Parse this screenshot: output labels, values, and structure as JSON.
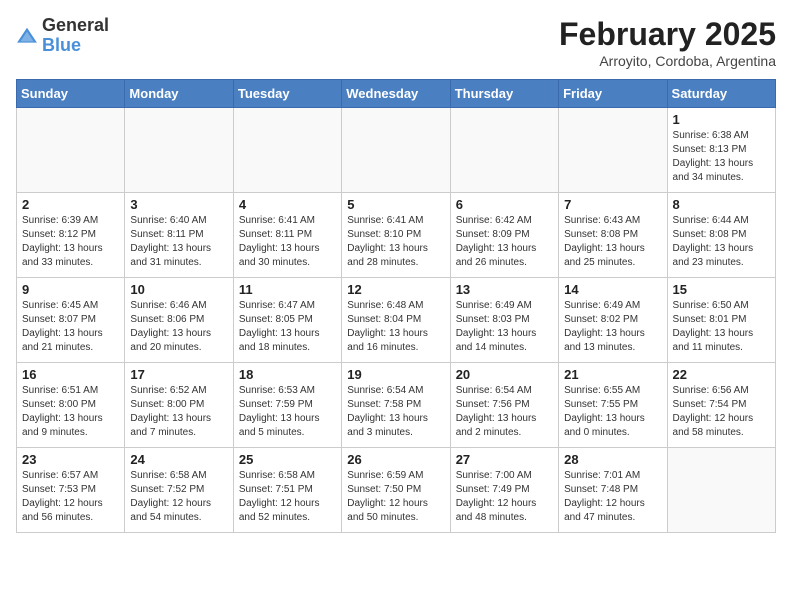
{
  "header": {
    "logo_general": "General",
    "logo_blue": "Blue",
    "month_title": "February 2025",
    "location": "Arroyito, Cordoba, Argentina"
  },
  "days_of_week": [
    "Sunday",
    "Monday",
    "Tuesday",
    "Wednesday",
    "Thursday",
    "Friday",
    "Saturday"
  ],
  "weeks": [
    [
      {
        "day": "",
        "info": ""
      },
      {
        "day": "",
        "info": ""
      },
      {
        "day": "",
        "info": ""
      },
      {
        "day": "",
        "info": ""
      },
      {
        "day": "",
        "info": ""
      },
      {
        "day": "",
        "info": ""
      },
      {
        "day": "1",
        "info": "Sunrise: 6:38 AM\nSunset: 8:13 PM\nDaylight: 13 hours\nand 34 minutes."
      }
    ],
    [
      {
        "day": "2",
        "info": "Sunrise: 6:39 AM\nSunset: 8:12 PM\nDaylight: 13 hours\nand 33 minutes."
      },
      {
        "day": "3",
        "info": "Sunrise: 6:40 AM\nSunset: 8:11 PM\nDaylight: 13 hours\nand 31 minutes."
      },
      {
        "day": "4",
        "info": "Sunrise: 6:41 AM\nSunset: 8:11 PM\nDaylight: 13 hours\nand 30 minutes."
      },
      {
        "day": "5",
        "info": "Sunrise: 6:41 AM\nSunset: 8:10 PM\nDaylight: 13 hours\nand 28 minutes."
      },
      {
        "day": "6",
        "info": "Sunrise: 6:42 AM\nSunset: 8:09 PM\nDaylight: 13 hours\nand 26 minutes."
      },
      {
        "day": "7",
        "info": "Sunrise: 6:43 AM\nSunset: 8:08 PM\nDaylight: 13 hours\nand 25 minutes."
      },
      {
        "day": "8",
        "info": "Sunrise: 6:44 AM\nSunset: 8:08 PM\nDaylight: 13 hours\nand 23 minutes."
      }
    ],
    [
      {
        "day": "9",
        "info": "Sunrise: 6:45 AM\nSunset: 8:07 PM\nDaylight: 13 hours\nand 21 minutes."
      },
      {
        "day": "10",
        "info": "Sunrise: 6:46 AM\nSunset: 8:06 PM\nDaylight: 13 hours\nand 20 minutes."
      },
      {
        "day": "11",
        "info": "Sunrise: 6:47 AM\nSunset: 8:05 PM\nDaylight: 13 hours\nand 18 minutes."
      },
      {
        "day": "12",
        "info": "Sunrise: 6:48 AM\nSunset: 8:04 PM\nDaylight: 13 hours\nand 16 minutes."
      },
      {
        "day": "13",
        "info": "Sunrise: 6:49 AM\nSunset: 8:03 PM\nDaylight: 13 hours\nand 14 minutes."
      },
      {
        "day": "14",
        "info": "Sunrise: 6:49 AM\nSunset: 8:02 PM\nDaylight: 13 hours\nand 13 minutes."
      },
      {
        "day": "15",
        "info": "Sunrise: 6:50 AM\nSunset: 8:01 PM\nDaylight: 13 hours\nand 11 minutes."
      }
    ],
    [
      {
        "day": "16",
        "info": "Sunrise: 6:51 AM\nSunset: 8:00 PM\nDaylight: 13 hours\nand 9 minutes."
      },
      {
        "day": "17",
        "info": "Sunrise: 6:52 AM\nSunset: 8:00 PM\nDaylight: 13 hours\nand 7 minutes."
      },
      {
        "day": "18",
        "info": "Sunrise: 6:53 AM\nSunset: 7:59 PM\nDaylight: 13 hours\nand 5 minutes."
      },
      {
        "day": "19",
        "info": "Sunrise: 6:54 AM\nSunset: 7:58 PM\nDaylight: 13 hours\nand 3 minutes."
      },
      {
        "day": "20",
        "info": "Sunrise: 6:54 AM\nSunset: 7:56 PM\nDaylight: 13 hours\nand 2 minutes."
      },
      {
        "day": "21",
        "info": "Sunrise: 6:55 AM\nSunset: 7:55 PM\nDaylight: 13 hours\nand 0 minutes."
      },
      {
        "day": "22",
        "info": "Sunrise: 6:56 AM\nSunset: 7:54 PM\nDaylight: 12 hours\nand 58 minutes."
      }
    ],
    [
      {
        "day": "23",
        "info": "Sunrise: 6:57 AM\nSunset: 7:53 PM\nDaylight: 12 hours\nand 56 minutes."
      },
      {
        "day": "24",
        "info": "Sunrise: 6:58 AM\nSunset: 7:52 PM\nDaylight: 12 hours\nand 54 minutes."
      },
      {
        "day": "25",
        "info": "Sunrise: 6:58 AM\nSunset: 7:51 PM\nDaylight: 12 hours\nand 52 minutes."
      },
      {
        "day": "26",
        "info": "Sunrise: 6:59 AM\nSunset: 7:50 PM\nDaylight: 12 hours\nand 50 minutes."
      },
      {
        "day": "27",
        "info": "Sunrise: 7:00 AM\nSunset: 7:49 PM\nDaylight: 12 hours\nand 48 minutes."
      },
      {
        "day": "28",
        "info": "Sunrise: 7:01 AM\nSunset: 7:48 PM\nDaylight: 12 hours\nand 47 minutes."
      },
      {
        "day": "",
        "info": ""
      }
    ]
  ]
}
